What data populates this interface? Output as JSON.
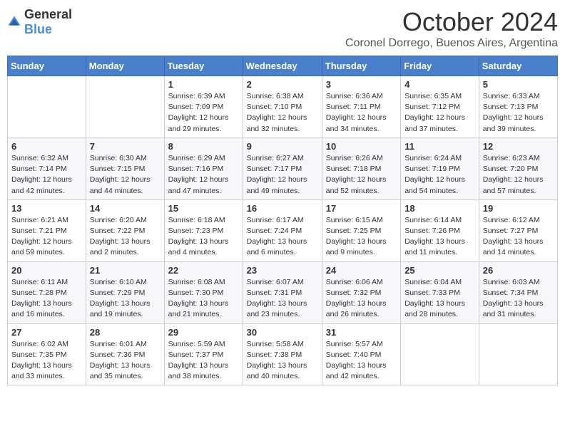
{
  "logo": {
    "text_general": "General",
    "text_blue": "Blue"
  },
  "header": {
    "month": "October 2024",
    "location": "Coronel Dorrego, Buenos Aires, Argentina"
  },
  "days_of_week": [
    "Sunday",
    "Monday",
    "Tuesday",
    "Wednesday",
    "Thursday",
    "Friday",
    "Saturday"
  ],
  "weeks": [
    [
      {
        "day": "",
        "info": ""
      },
      {
        "day": "",
        "info": ""
      },
      {
        "day": "1",
        "info": "Sunrise: 6:39 AM\nSunset: 7:09 PM\nDaylight: 12 hours and 29 minutes."
      },
      {
        "day": "2",
        "info": "Sunrise: 6:38 AM\nSunset: 7:10 PM\nDaylight: 12 hours and 32 minutes."
      },
      {
        "day": "3",
        "info": "Sunrise: 6:36 AM\nSunset: 7:11 PM\nDaylight: 12 hours and 34 minutes."
      },
      {
        "day": "4",
        "info": "Sunrise: 6:35 AM\nSunset: 7:12 PM\nDaylight: 12 hours and 37 minutes."
      },
      {
        "day": "5",
        "info": "Sunrise: 6:33 AM\nSunset: 7:13 PM\nDaylight: 12 hours and 39 minutes."
      }
    ],
    [
      {
        "day": "6",
        "info": "Sunrise: 6:32 AM\nSunset: 7:14 PM\nDaylight: 12 hours and 42 minutes."
      },
      {
        "day": "7",
        "info": "Sunrise: 6:30 AM\nSunset: 7:15 PM\nDaylight: 12 hours and 44 minutes."
      },
      {
        "day": "8",
        "info": "Sunrise: 6:29 AM\nSunset: 7:16 PM\nDaylight: 12 hours and 47 minutes."
      },
      {
        "day": "9",
        "info": "Sunrise: 6:27 AM\nSunset: 7:17 PM\nDaylight: 12 hours and 49 minutes."
      },
      {
        "day": "10",
        "info": "Sunrise: 6:26 AM\nSunset: 7:18 PM\nDaylight: 12 hours and 52 minutes."
      },
      {
        "day": "11",
        "info": "Sunrise: 6:24 AM\nSunset: 7:19 PM\nDaylight: 12 hours and 54 minutes."
      },
      {
        "day": "12",
        "info": "Sunrise: 6:23 AM\nSunset: 7:20 PM\nDaylight: 12 hours and 57 minutes."
      }
    ],
    [
      {
        "day": "13",
        "info": "Sunrise: 6:21 AM\nSunset: 7:21 PM\nDaylight: 12 hours and 59 minutes."
      },
      {
        "day": "14",
        "info": "Sunrise: 6:20 AM\nSunset: 7:22 PM\nDaylight: 13 hours and 2 minutes."
      },
      {
        "day": "15",
        "info": "Sunrise: 6:18 AM\nSunset: 7:23 PM\nDaylight: 13 hours and 4 minutes."
      },
      {
        "day": "16",
        "info": "Sunrise: 6:17 AM\nSunset: 7:24 PM\nDaylight: 13 hours and 6 minutes."
      },
      {
        "day": "17",
        "info": "Sunrise: 6:15 AM\nSunset: 7:25 PM\nDaylight: 13 hours and 9 minutes."
      },
      {
        "day": "18",
        "info": "Sunrise: 6:14 AM\nSunset: 7:26 PM\nDaylight: 13 hours and 11 minutes."
      },
      {
        "day": "19",
        "info": "Sunrise: 6:12 AM\nSunset: 7:27 PM\nDaylight: 13 hours and 14 minutes."
      }
    ],
    [
      {
        "day": "20",
        "info": "Sunrise: 6:11 AM\nSunset: 7:28 PM\nDaylight: 13 hours and 16 minutes."
      },
      {
        "day": "21",
        "info": "Sunrise: 6:10 AM\nSunset: 7:29 PM\nDaylight: 13 hours and 19 minutes."
      },
      {
        "day": "22",
        "info": "Sunrise: 6:08 AM\nSunset: 7:30 PM\nDaylight: 13 hours and 21 minutes."
      },
      {
        "day": "23",
        "info": "Sunrise: 6:07 AM\nSunset: 7:31 PM\nDaylight: 13 hours and 23 minutes."
      },
      {
        "day": "24",
        "info": "Sunrise: 6:06 AM\nSunset: 7:32 PM\nDaylight: 13 hours and 26 minutes."
      },
      {
        "day": "25",
        "info": "Sunrise: 6:04 AM\nSunset: 7:33 PM\nDaylight: 13 hours and 28 minutes."
      },
      {
        "day": "26",
        "info": "Sunrise: 6:03 AM\nSunset: 7:34 PM\nDaylight: 13 hours and 31 minutes."
      }
    ],
    [
      {
        "day": "27",
        "info": "Sunrise: 6:02 AM\nSunset: 7:35 PM\nDaylight: 13 hours and 33 minutes."
      },
      {
        "day": "28",
        "info": "Sunrise: 6:01 AM\nSunset: 7:36 PM\nDaylight: 13 hours and 35 minutes."
      },
      {
        "day": "29",
        "info": "Sunrise: 5:59 AM\nSunset: 7:37 PM\nDaylight: 13 hours and 38 minutes."
      },
      {
        "day": "30",
        "info": "Sunrise: 5:58 AM\nSunset: 7:38 PM\nDaylight: 13 hours and 40 minutes."
      },
      {
        "day": "31",
        "info": "Sunrise: 5:57 AM\nSunset: 7:40 PM\nDaylight: 13 hours and 42 minutes."
      },
      {
        "day": "",
        "info": ""
      },
      {
        "day": "",
        "info": ""
      }
    ]
  ]
}
